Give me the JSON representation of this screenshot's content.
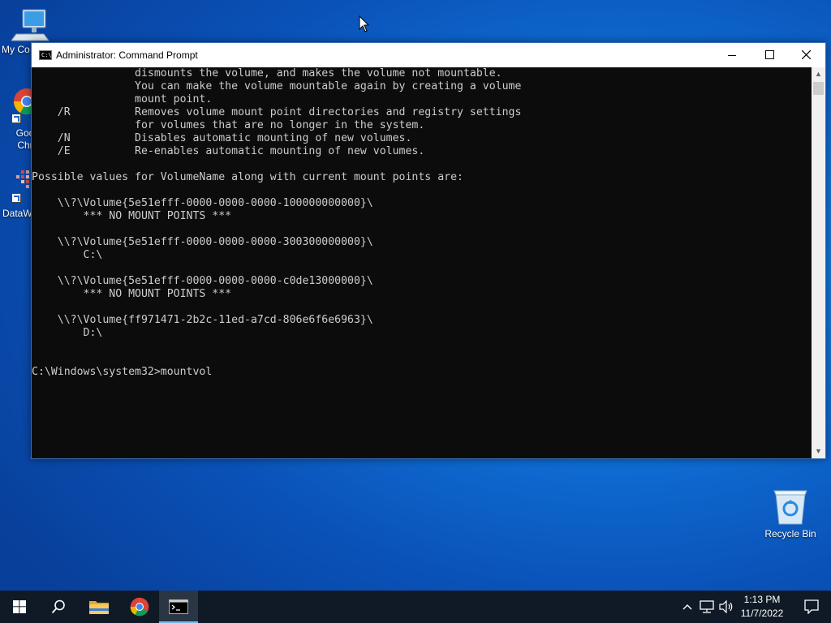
{
  "desktop": {
    "icons": [
      {
        "name": "desktop-icon-my-computer",
        "label": "My Co"
      },
      {
        "name": "desktop-icon-google-chrome",
        "label": "Goo\nChr"
      },
      {
        "name": "desktop-icon-dataw",
        "label": "DataW"
      },
      {
        "name": "desktop-icon-recycle-bin",
        "label": "Recycle Bin"
      }
    ]
  },
  "window": {
    "title": "Administrator: Command Prompt",
    "icon_text": "C:\\",
    "controls": {
      "minimize": "minimize-icon",
      "maximize": "maximize-icon",
      "close": "close-icon"
    }
  },
  "console": {
    "lines": [
      "                dismounts the volume, and makes the volume not mountable.",
      "                You can make the volume mountable again by creating a volume",
      "                mount point.",
      "    /R          Removes volume mount point directories and registry settings",
      "                for volumes that are no longer in the system.",
      "    /N          Disables automatic mounting of new volumes.",
      "    /E          Re-enables automatic mounting of new volumes.",
      "",
      "Possible values for VolumeName along with current mount points are:",
      "",
      "    \\\\?\\Volume{5e51efff-0000-0000-0000-100000000000}\\",
      "        *** NO MOUNT POINTS ***",
      "",
      "    \\\\?\\Volume{5e51efff-0000-0000-0000-300300000000}\\",
      "        C:\\",
      "",
      "    \\\\?\\Volume{5e51efff-0000-0000-0000-c0de13000000}\\",
      "        *** NO MOUNT POINTS ***",
      "",
      "    \\\\?\\Volume{ff971471-2b2c-11ed-a7cd-806e6f6e6963}\\",
      "        D:\\",
      "",
      "",
      "C:\\Windows\\system32>mountvol"
    ]
  },
  "taskbar": {
    "items": [
      "start-button",
      "search-button",
      "file-explorer",
      "google-chrome",
      "command-prompt"
    ],
    "tray": {
      "icons": [
        "chevron-up-icon",
        "network-icon",
        "volume-icon"
      ],
      "time": "1:13 PM",
      "date": "11/7/2022",
      "notifications": "notification-icon"
    }
  }
}
